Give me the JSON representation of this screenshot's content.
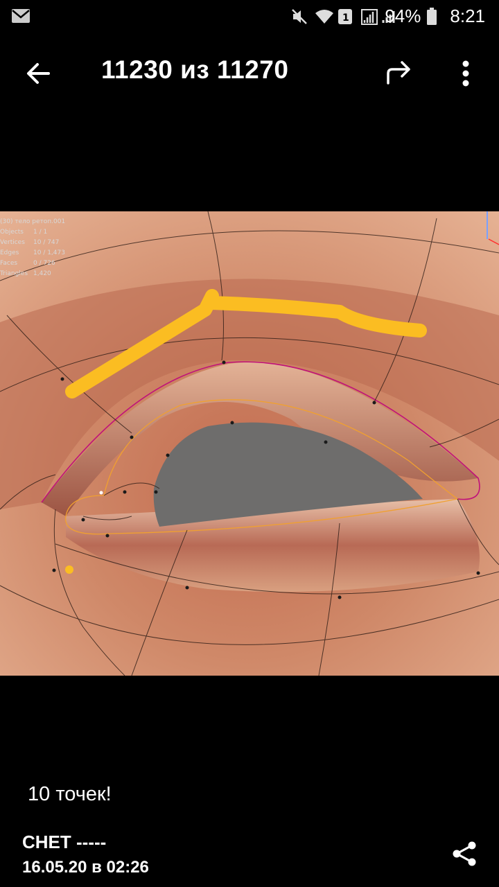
{
  "status_bar": {
    "battery": "94%",
    "time": "8:21",
    "icons": [
      "mail-icon",
      "mute-icon",
      "wifi-icon",
      "sim1-icon",
      "signal-icon",
      "battery-icon"
    ]
  },
  "toolbar": {
    "title": "11230 из 11270",
    "icons": [
      "back-arrow-icon",
      "share-forward-icon",
      "more-vert-icon"
    ]
  },
  "photo": {
    "overlay_lines": [
      {
        "k": "",
        "v": "(30) тело ретоп.001"
      },
      {
        "k": "Objects",
        "v": "1 / 1"
      },
      {
        "k": "Vertices",
        "v": "10 / 747"
      },
      {
        "k": "Edges",
        "v": "10 / 1,473"
      },
      {
        "k": "Faces",
        "v": "0 / 726"
      },
      {
        "k": "Triangles",
        "v": "1,420"
      }
    ],
    "colors": {
      "skin": "#d08a6a",
      "highlight": "#fbbd22",
      "eye": "#6e6d6c",
      "edge": "#c0117a"
    }
  },
  "post": {
    "caption": "10 точек!",
    "author": "СНЕТ -----",
    "date": "16.05.20 в 02:26"
  }
}
